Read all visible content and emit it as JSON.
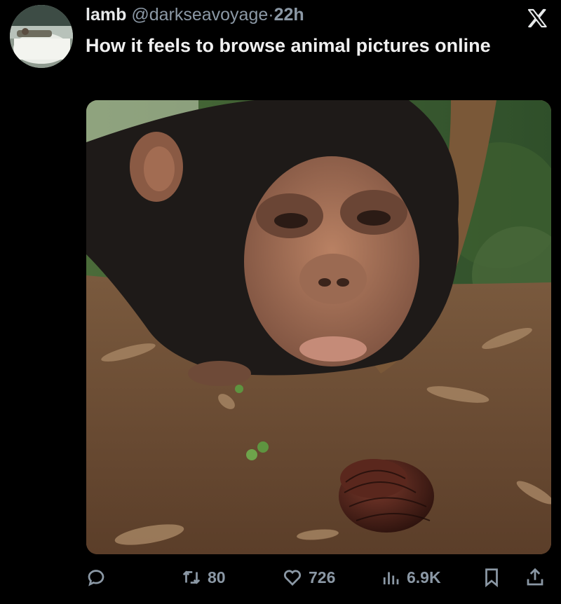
{
  "tweet": {
    "author_name": "lamb",
    "author_handle": "@darkseavoyage",
    "separator": "·",
    "time": "22h",
    "text": "How it feels to browse animal pictures online"
  },
  "image": {
    "subject": "baby chimpanzee looking at a coiled millipede"
  },
  "actions": {
    "reply_count": "",
    "retweet_count": "80",
    "like_count": "726",
    "views_count": "6.9K"
  },
  "icons": [
    "x-logo-icon",
    "reply-icon",
    "retweet-icon",
    "heart-icon",
    "views-icon",
    "bookmark-icon",
    "share-icon"
  ]
}
